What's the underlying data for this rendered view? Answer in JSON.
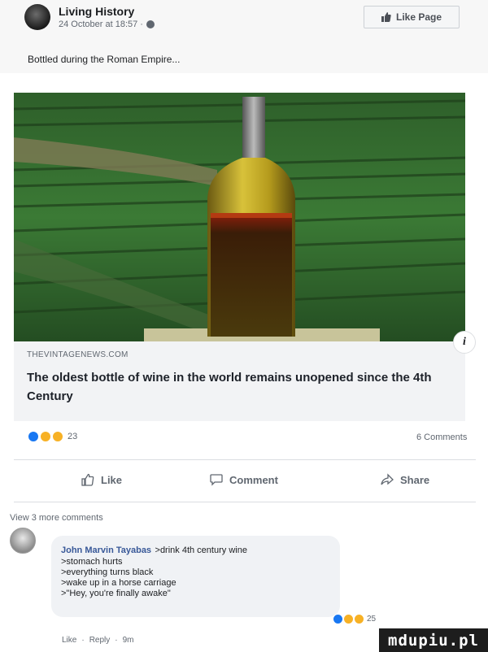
{
  "post": {
    "page_name": "Living History",
    "timestamp": "24 October at 18:57 ·",
    "like_page_label": "Like Page",
    "caption": "Bottled during the Roman Empire..."
  },
  "link": {
    "domain": "THEVINTAGENEWS.COM",
    "title": "The oldest bottle of wine in the world remains unopened since the 4th Century",
    "info_label": "i"
  },
  "stats": {
    "reaction_count": "23",
    "comments_count": "6 Comments"
  },
  "actions": {
    "like": "Like",
    "comment": "Comment",
    "share": "Share"
  },
  "comments": {
    "view_more": "View 3 more comments",
    "items": [
      {
        "author": "John Marvin Tayabas",
        "lines": [
          ">drink 4th century wine",
          ">stomach hurts",
          ">everything turns black",
          ">wake up in a horse carriage",
          ">\"Hey, you're finally awake\""
        ],
        "reaction_count": "25",
        "like_label": "Like",
        "reply_label": "Reply",
        "age": "9m"
      }
    ]
  },
  "watermark": "mdupiu.pl",
  "colors": {
    "accent_link": "#385898",
    "like_blue": "#1877f2",
    "muted_text": "#606770",
    "link_bg": "#f2f3f5"
  }
}
